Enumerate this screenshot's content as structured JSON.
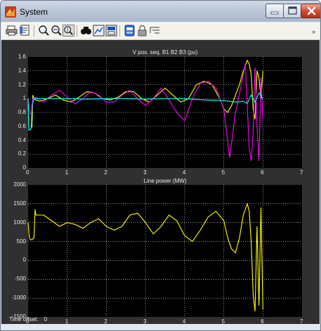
{
  "window": {
    "title": "System"
  },
  "toolbar": {
    "buttons": [
      {
        "name": "print-icon"
      },
      {
        "name": "parameters-icon"
      },
      {
        "name": "zoom-in-icon"
      },
      {
        "name": "zoom-x-icon"
      },
      {
        "name": "zoom-y-icon"
      },
      {
        "name": "autoscale-icon"
      },
      {
        "name": "save-axes-icon"
      },
      {
        "name": "restore-axes-icon"
      },
      {
        "name": "floating-scope-icon"
      },
      {
        "name": "lock-icon"
      },
      {
        "name": "signal-selection-icon"
      }
    ],
    "overflow_icon": "chevron-right-icon"
  },
  "status": {
    "time_offset_label": "Time offset:",
    "time_offset_value": "0"
  },
  "colors": {
    "plot_bg": "#000000",
    "canvas_bg": "#303030",
    "yellow": "#ffff00",
    "magenta": "#ff00ff",
    "cyan": "#00ffff"
  },
  "chart_data": [
    {
      "type": "line",
      "title": "V pos. seq. B1 B2 B3 (pu)",
      "xlim": [
        0,
        7
      ],
      "ylim": [
        0,
        1.6
      ],
      "xticks": [
        "0",
        "1",
        "2",
        "3",
        "4",
        "5",
        "6",
        "7"
      ],
      "yticks": [
        "0",
        "0.2",
        "0.4",
        "0.6",
        "0.8",
        "1",
        "1.2",
        "1.4",
        "1.6"
      ],
      "grid": true,
      "series": [
        {
          "color": "#ffff00",
          "x": [
            0,
            0.02,
            0.05,
            0.08,
            0.1,
            0.12,
            0.15,
            0.2,
            0.3,
            0.5,
            0.7,
            0.9,
            1.1,
            1.3,
            1.5,
            1.7,
            1.9,
            2.1,
            2.3,
            2.5,
            2.7,
            2.9,
            3.1,
            3.3,
            3.5,
            3.7,
            3.9,
            4.1,
            4.3,
            4.5,
            4.7,
            4.9,
            5.0,
            5.1,
            5.2,
            5.3,
            5.4,
            5.5,
            5.6,
            5.65,
            5.7,
            5.75,
            5.8,
            5.85,
            5.9,
            5.95,
            6.0
          ],
          "y": [
            1.0,
            0.55,
            0.55,
            0.58,
            0.6,
            1.05,
            1.0,
            0.98,
            0.96,
            1.0,
            1.05,
            0.98,
            0.95,
            1.02,
            1.1,
            1.08,
            1.0,
            0.98,
            1.02,
            1.1,
            1.1,
            1.0,
            0.95,
            1.05,
            1.15,
            1.05,
            0.95,
            1.0,
            1.2,
            1.25,
            1.2,
            1.0,
            0.85,
            0.8,
            0.9,
            1.05,
            1.2,
            1.4,
            1.55,
            1.5,
            1.35,
            0.85,
            0.7,
            1.4,
            1.3,
            1.0,
            1.4
          ]
        },
        {
          "color": "#ff00ff",
          "x": [
            0,
            0.05,
            0.08,
            0.1,
            0.12,
            0.2,
            0.4,
            0.6,
            0.8,
            1.0,
            1.2,
            1.4,
            1.6,
            1.8,
            2.0,
            2.2,
            2.4,
            2.6,
            2.8,
            3.0,
            3.2,
            3.4,
            3.6,
            3.8,
            4.0,
            4.2,
            4.4,
            4.6,
            4.8,
            5.0,
            5.15,
            5.3,
            5.45,
            5.55,
            5.6,
            5.65,
            5.7,
            5.75,
            5.8,
            5.85,
            5.9,
            5.95,
            6.0
          ],
          "y": [
            1.0,
            0.78,
            0.78,
            0.8,
            1.0,
            1.02,
            0.95,
            1.05,
            1.12,
            1.02,
            0.92,
            1.0,
            1.1,
            1.05,
            0.95,
            0.95,
            1.05,
            1.12,
            1.0,
            0.9,
            1.0,
            1.15,
            0.98,
            0.8,
            0.68,
            1.0,
            1.22,
            1.25,
            1.15,
            0.85,
            0.15,
            0.8,
            1.2,
            1.5,
            0.9,
            0.3,
            0.1,
            0.5,
            1.45,
            0.6,
            0.1,
            1.3,
            0.7
          ]
        },
        {
          "color": "#00ffff",
          "x": [
            0,
            0.02,
            0.05,
            0.08,
            0.1,
            0.15,
            0.3,
            0.6,
            1.0,
            1.5,
            2.0,
            2.5,
            3.0,
            3.5,
            4.0,
            4.5,
            5.0,
            5.3,
            5.5,
            5.6,
            5.7,
            5.8,
            5.9,
            6.0
          ],
          "y": [
            1.0,
            0.55,
            0.55,
            0.58,
            0.9,
            1.0,
            1.0,
            1.0,
            1.0,
            0.99,
            1.0,
            1.0,
            0.99,
            1.0,
            1.0,
            0.98,
            0.97,
            0.95,
            0.96,
            0.93,
            1.05,
            0.95,
            1.08,
            1.0
          ]
        }
      ]
    },
    {
      "type": "line",
      "title": "Line power (MW)",
      "xlim": [
        0,
        7
      ],
      "ylim": [
        -1500,
        2000
      ],
      "xticks": [
        "0",
        "1",
        "2",
        "3",
        "4",
        "5",
        "6",
        "7"
      ],
      "yticks": [
        "-1500",
        "-1000",
        "-500",
        "0",
        "500",
        "1000",
        "1500",
        "2000"
      ],
      "grid": true,
      "series": [
        {
          "color": "#ffff00",
          "x": [
            0,
            0.03,
            0.06,
            0.1,
            0.15,
            0.18,
            0.2,
            0.4,
            0.6,
            0.8,
            1.0,
            1.2,
            1.4,
            1.6,
            1.8,
            2.0,
            2.2,
            2.4,
            2.6,
            2.8,
            3.0,
            3.2,
            3.4,
            3.6,
            3.8,
            4.0,
            4.2,
            4.4,
            4.6,
            4.8,
            5.0,
            5.1,
            5.2,
            5.3,
            5.4,
            5.5,
            5.6,
            5.65,
            5.7,
            5.75,
            5.8,
            5.85,
            5.9,
            5.95,
            6.0
          ],
          "y": [
            1000,
            600,
            550,
            550,
            600,
            1350,
            1200,
            1200,
            1050,
            900,
            1000,
            950,
            850,
            1000,
            1100,
            900,
            800,
            900,
            1200,
            1250,
            1000,
            700,
            900,
            1200,
            1050,
            650,
            500,
            800,
            1150,
            1300,
            1050,
            600,
            300,
            200,
            600,
            1200,
            1500,
            1300,
            500,
            -900,
            -1350,
            900,
            -1200,
            1400,
            -1300
          ]
        }
      ]
    }
  ]
}
